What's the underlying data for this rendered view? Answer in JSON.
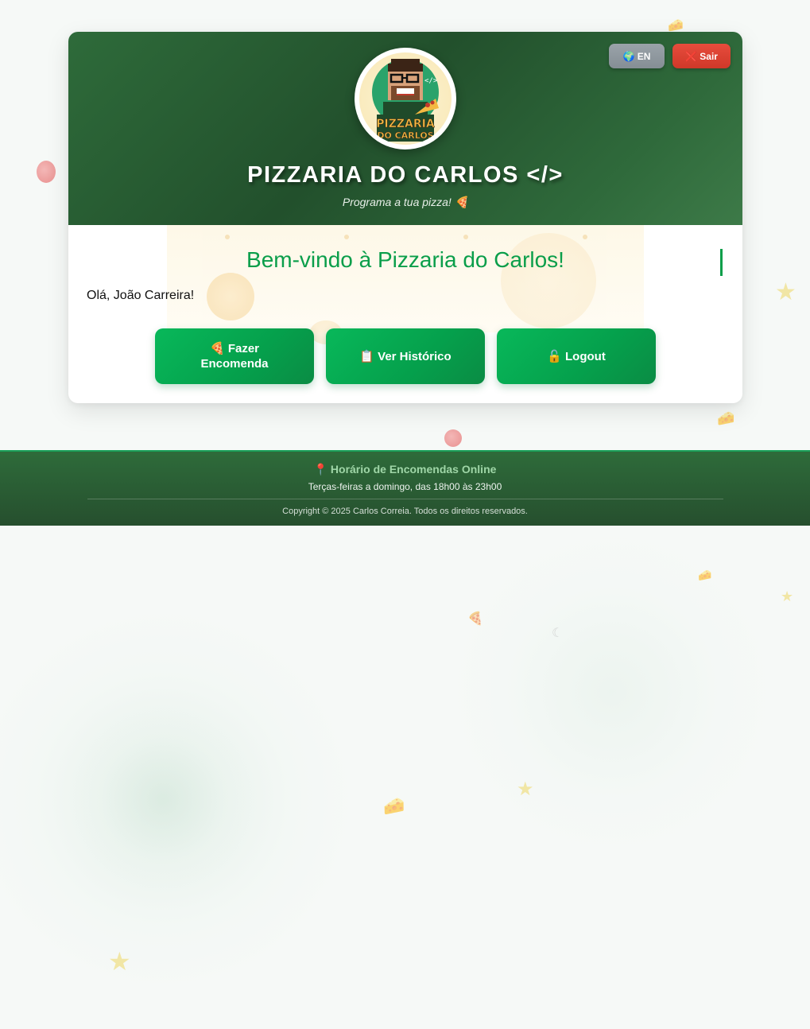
{
  "header": {
    "lang_button": "🌍 EN",
    "exit_button": "❌ Sair",
    "logo_text_line1": "PIZZARIA",
    "logo_text_line2": "DO CARLOS",
    "title": "PIZZARIA DO CARLOS </>",
    "subtitle": "Programa a tua pizza! 🍕"
  },
  "main": {
    "welcome": "Bem-vindo à Pizzaria do Carlos!",
    "greeting": "Olá, João Carreira!",
    "buttons": {
      "order": "🍕 Fazer Encomenda",
      "history": "📋 Ver Histórico",
      "logout": "🔓 Logout"
    }
  },
  "footer": {
    "hours_title": "📍 Horário de Encomendas Online",
    "hours_text": "Terças-feiras a domingo, das 18h00 às 23h00",
    "copyright": "Copyright © 2025 Carlos Correia. Todos os direitos reservados."
  },
  "colors": {
    "header_green": "#22502c",
    "accent_green": "#0a9e4a",
    "exit_red": "#e74c3c"
  }
}
